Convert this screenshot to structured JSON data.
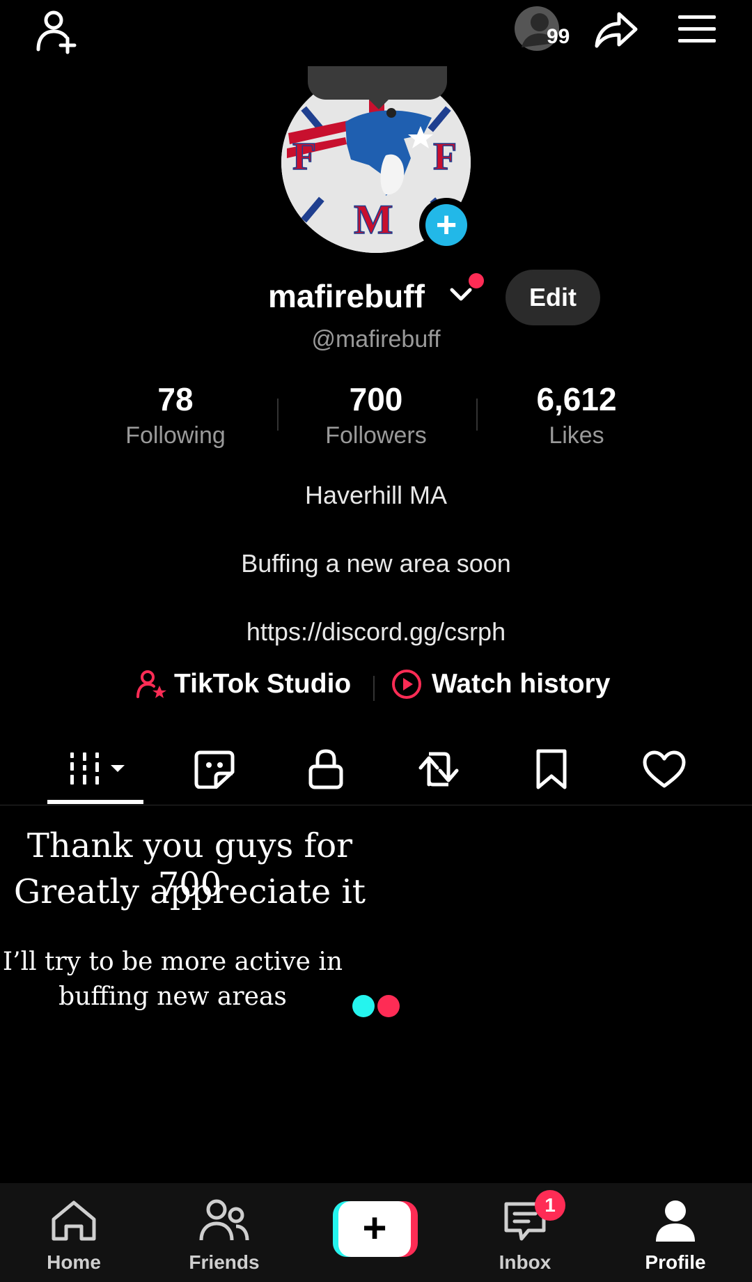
{
  "topbar": {
    "add_friend_icon": "add-user-icon",
    "notification_count": "99",
    "share_icon": "share-icon",
    "menu_icon": "menu-icon"
  },
  "profile": {
    "avatar_logo_letters": [
      "F",
      "F",
      "M"
    ],
    "display_name": "mafirebuff",
    "handle": "@mafirebuff",
    "edit_label": "Edit"
  },
  "stats": [
    {
      "value": "78",
      "label": "Following"
    },
    {
      "value": "700",
      "label": "Followers"
    },
    {
      "value": "6,612",
      "label": "Likes"
    }
  ],
  "bio": {
    "location": "Haverhill MA",
    "text": "Buffing a new area soon",
    "link": "https://discord.gg/csrph"
  },
  "links_row": {
    "studio_label": "TikTok Studio",
    "history_label": "Watch history"
  },
  "tabs": [
    "videos-grid-icon",
    "sticker-icon",
    "lock-icon",
    "repost-icon",
    "bookmark-icon",
    "heart-icon"
  ],
  "post": {
    "line1": "Thank you guys for 700",
    "line2": "Greatly appreciate it",
    "line3": "I’ll try to be more active in",
    "line4": "buffing new areas"
  },
  "bottom_nav": {
    "home": "Home",
    "friends": "Friends",
    "create": "+",
    "inbox": "Inbox",
    "inbox_badge": "1",
    "profile": "Profile"
  },
  "colors": {
    "accent_red": "#fe2c55",
    "accent_cyan": "#25f4ee",
    "avatar_plus_blue": "#22b8e8"
  }
}
